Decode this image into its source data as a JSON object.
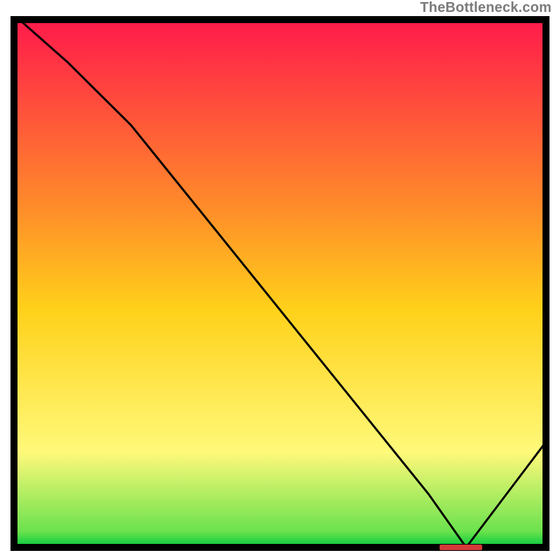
{
  "watermark": "TheBottleneck.com",
  "chart_data": {
    "type": "line",
    "title": "",
    "xlabel": "",
    "ylabel": "",
    "xlim": [
      0,
      100
    ],
    "ylim": [
      0,
      100
    ],
    "x": [
      1,
      10,
      22,
      30,
      38,
      46,
      54,
      62,
      70,
      78,
      85,
      100
    ],
    "values": [
      100,
      92,
      80,
      70,
      60,
      50,
      40,
      30,
      20,
      10,
      0,
      20
    ],
    "optimum_marker": {
      "x_start": 80,
      "x_end": 88,
      "y": 0
    },
    "background": {
      "type": "vertical_gradient",
      "stops": [
        {
          "pos": 0.0,
          "color": "#ff1a4b"
        },
        {
          "pos": 0.35,
          "color": "#ff8a2a"
        },
        {
          "pos": 0.55,
          "color": "#ffd11a"
        },
        {
          "pos": 0.82,
          "color": "#fff97a"
        },
        {
          "pos": 0.97,
          "color": "#6be24d"
        },
        {
          "pos": 1.0,
          "color": "#00c83c"
        }
      ]
    },
    "axis_color": "#000000",
    "line_color": "#000000",
    "marker_color": "#d43a3a"
  }
}
